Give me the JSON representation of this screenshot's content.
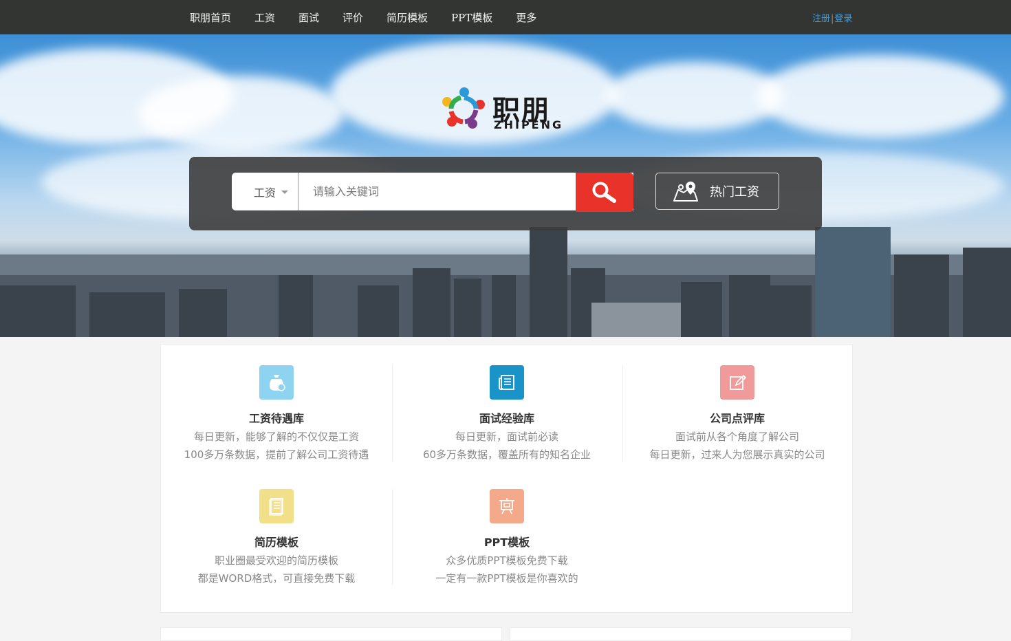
{
  "nav": {
    "items": [
      "职朋首页",
      "工资",
      "面试",
      "评价",
      "简历模板",
      "PPT模板",
      "更多"
    ],
    "register": "注册",
    "separator": "|",
    "login": "登录"
  },
  "brand": {
    "name_cn": "职朋",
    "name_en": "ZHIPENG"
  },
  "search": {
    "type_selected": "工资",
    "placeholder": "请输入关键词",
    "search_icon": "search-icon",
    "hot_label": "热门工资",
    "hot_icon": "map-pin-icon"
  },
  "features": [
    {
      "icon": "money-bag-icon",
      "color": "#8ed3f0",
      "title": "工资待遇库",
      "line1": "每日更新，能够了解的不仅仅是工资",
      "line2": "100多万条数据，提前了解公司工资待遇"
    },
    {
      "icon": "newspaper-icon",
      "color": "#1a93c8",
      "title": "面试经验库",
      "line1": "每日更新，面试前必读",
      "line2": "60多万条数据，覆盖所有的知名企业"
    },
    {
      "icon": "edit-note-icon",
      "color": "#f09a9a",
      "title": "公司点评库",
      "line1": "面试前从各个角度了解公司",
      "line2": "每日更新，过来人为您展示真实的公司"
    },
    {
      "icon": "document-icon",
      "color": "#f1df8a",
      "title": "简历模板",
      "line1": "职业圈最受欢迎的简历模板",
      "line2": "都是WORD格式，可直接免费下载"
    },
    {
      "icon": "presentation-icon",
      "color": "#f4a98b",
      "title": "PPT模板",
      "line1": "众多优质PPT模板免费下载",
      "line2": "一定有一款PPT模板是你喜欢的"
    }
  ],
  "colors": {
    "topbar": "#333533",
    "accent_link": "#3c9ee0",
    "search_button": "#e8322a"
  }
}
